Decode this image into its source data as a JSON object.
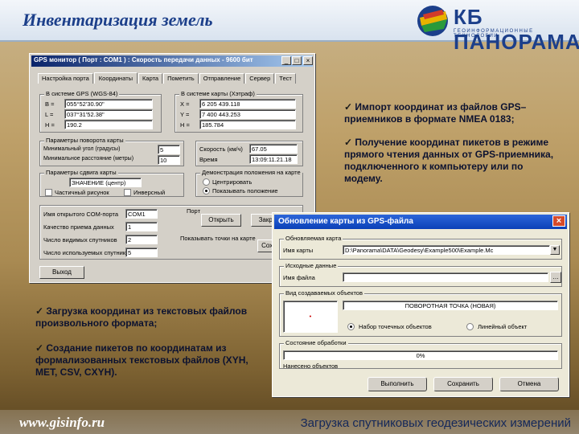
{
  "slide": {
    "title": "Инвентаризация земель",
    "logo_text": "КБ ПАНОРАМА",
    "logo_sub": "ГЕОИНФОРМАЦИОННЫЕ ТЕХНОЛОГИИ",
    "site": "www.gisinfo.ru",
    "slogan": "Загрузка спутниковых геодезических измерений"
  },
  "gps_window": {
    "title": "GPS монитор  ( Порт : COM1 ) : Скорость передачи данных - 9600 бит",
    "tabs": [
      "Настройка порта",
      "Координаты",
      "Карта",
      "Пометить",
      "Отправление",
      "Сервер",
      "Тест"
    ],
    "gps_group_label": "В системе GPS (WGS-84)",
    "map_group_label": "В системе карты (Хэтраф)",
    "gps_coords": [
      {
        "label": "B =",
        "value": "055°52'30.90\""
      },
      {
        "label": "L =",
        "value": "037°31'52.38\""
      },
      {
        "label": "H =",
        "value": "190.2"
      }
    ],
    "map_coords": [
      {
        "label": "X =",
        "value": "6 205 439.118"
      },
      {
        "label": "Y =",
        "value": "7 400 443.253"
      },
      {
        "label": "H =",
        "value": "185.784"
      }
    ],
    "pos_group_label": "Параметры поворота карты",
    "pos_rows": [
      {
        "label": "Минимальный угол (градусы)",
        "value": "5"
      },
      {
        "label": "Минимальное расстояние (метры)",
        "value": "10"
      }
    ],
    "speed_label": "Скорость (км/ч)",
    "speed_value": "67.05",
    "time_label": "Время",
    "time_value": "13:09:11.21.18",
    "map_shift_label": "Параметры сдвига карты",
    "map_shift_value": "ЗНАЧЕНИЕ (центр)",
    "check_partial": "Частичный рисунок",
    "check_inverse": "Инверсный",
    "show_label": "Демонстрация положения на карте",
    "radio_center": "Центрировать",
    "radio_show": "Показывать положение",
    "port_label": "Имя открытого COM-порта",
    "port_value": "COM1",
    "quality_label": "Качество приема данных",
    "quality_value": "1",
    "sat_label": "Число видимых спутников",
    "sat_value": "2",
    "sat_used_label": "Число используемых спутников",
    "sat_used_value": "5",
    "port_btn": "Порт",
    "open_btn": "Открыть",
    "close_btn": "Закрыть",
    "log_label": "Показывать точки на карте",
    "log_btn": "Сохранить",
    "exit_btn": "Выход"
  },
  "map_dialog": {
    "title": "Обновление карты из GPS-файла",
    "map_group_label": "Обновляемая карта",
    "map_name_label": "Имя карты",
    "map_name_value": "D:\\Panorama\\DATA\\Geodesy\\Example500\\Example.Mc",
    "src_group_label": "Исходные данные",
    "file_name_label": "Имя файла",
    "obj_group_label": "Вид создаваемых объектов",
    "obj_value": "ПОВОРОТНАЯ ТОЧКА (НОВАЯ)",
    "radio_points": "Набор точечных объектов",
    "radio_line": "Линейный объект",
    "status_group_label": "Состояние обработки",
    "progress_text": "0%",
    "progress_pct": 0,
    "created_label": "Нанесено объектов",
    "run_btn": "Выполнить",
    "save_btn": "Сохранить",
    "cancel_btn": "Отмена"
  },
  "notes": {
    "n1": "Импорт координат из файлов GPS–приемников в формате NMEA 0183;",
    "n2": "Получение координат пикетов в режиме прямого чтения данных от GPS-приемника, подключенного к компьютеру или по модему.",
    "n3": "Загрузка координат из текстовых файлов произвольного формата;",
    "n4": "Создание пикетов по координатам из формализованных текстовых файлов (XYH, MET, CSV, CXYH)."
  }
}
